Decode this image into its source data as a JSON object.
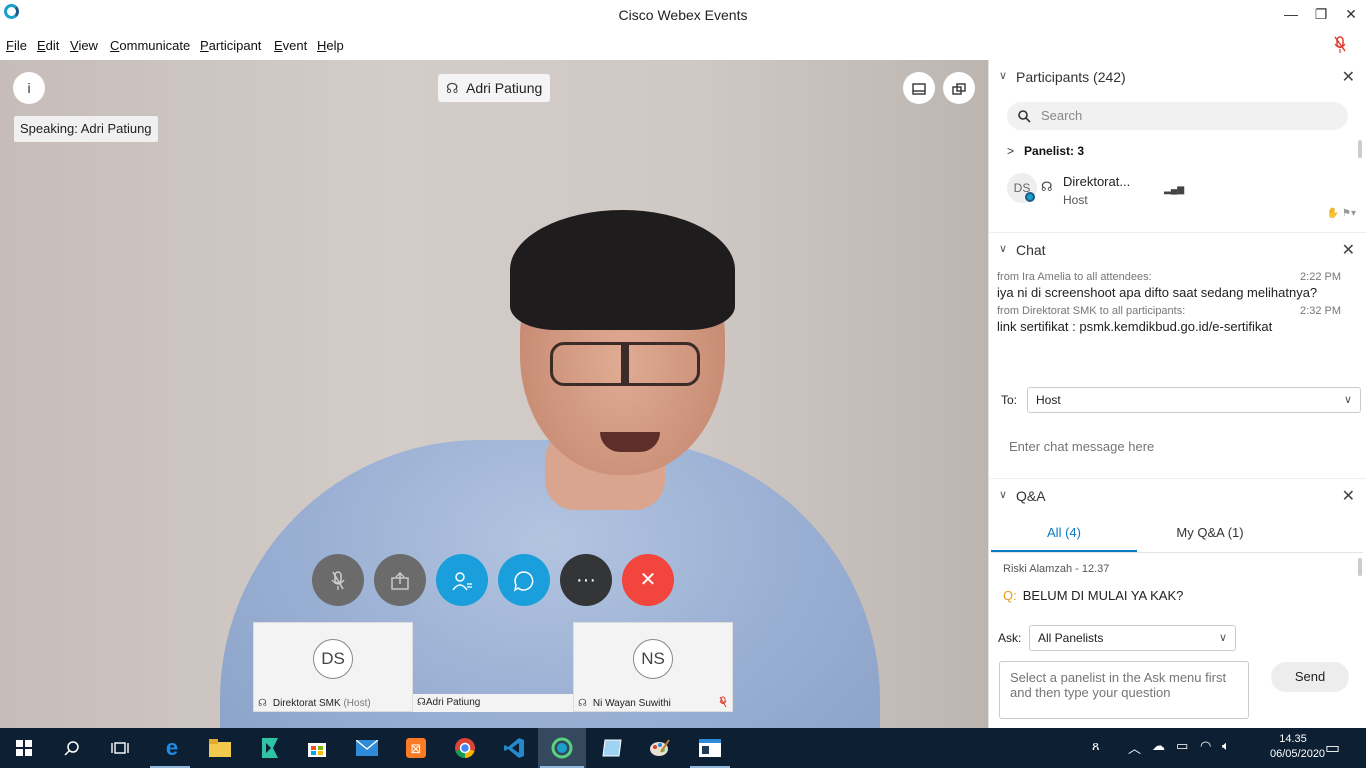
{
  "window": {
    "title": "Cisco Webex Events",
    "minimize": "—",
    "restore": "❐",
    "close": "✕"
  },
  "menu": {
    "items": [
      {
        "key": "F",
        "rest": "ile"
      },
      {
        "key": "E",
        "rest": "dit"
      },
      {
        "key": "V",
        "rest": "iew"
      },
      {
        "key": "C",
        "rest": "ommunicate"
      },
      {
        "key": "P",
        "rest": "articipant"
      },
      {
        "key": "E",
        "rest": "vent"
      },
      {
        "key": "H",
        "rest": "elp"
      }
    ]
  },
  "video": {
    "speaking_text": "Speaking: Adri Patiung",
    "active_speaker": "Adri Patiung",
    "info_icon": "i"
  },
  "controls": {
    "more_label": "···",
    "end_label": "✕"
  },
  "thumbnails": [
    {
      "initials": "DS",
      "name": "Direktorat SMK",
      "suffix": "(Host)"
    },
    {
      "initials": "",
      "name": "Adri Patiung",
      "suffix": ""
    },
    {
      "initials": "NS",
      "name": "Ni Wayan Suwithi",
      "suffix": ""
    }
  ],
  "participants": {
    "header": "Participants (242)",
    "search_placeholder": "Search",
    "panelist_label": "Panelist: 3",
    "first": {
      "initials": "DS",
      "name": "Direktorat...",
      "role": "Host"
    }
  },
  "chat": {
    "header": "Chat",
    "messages": [
      {
        "from": "from Ira Amelia to all attendees:",
        "time": "2:22 PM",
        "text": "iya ni di screenshoot apa difto saat sedang melihatnya?"
      },
      {
        "from": "from Direktorat SMK to all participants:",
        "time": "2:32 PM",
        "text": "link sertifikat : psmk.kemdikbud.go.id/e-sertifikat"
      }
    ],
    "to_label": "To:",
    "to_value": "Host",
    "input_placeholder": "Enter chat message here"
  },
  "qa": {
    "header": "Q&A",
    "tabs": [
      "All (4)",
      "My Q&A (1)"
    ],
    "question_from": "Riski Alamzah - 12.37",
    "question_prefix": "Q:",
    "question_text": "BELUM DI MULAI YA KAK?",
    "ask_label": "Ask:",
    "ask_value": "All Panelists",
    "ask_placeholder": "Select a panelist in the Ask menu first and then type your question",
    "send_label": "Send"
  },
  "taskbar": {
    "time": "14.35",
    "date": "06/05/2020"
  },
  "colors": {
    "accent": "#0a7bc2",
    "webex_blue": "#1a9fc9",
    "end_red": "#f2453d",
    "taskbar": "#0c1f33"
  }
}
